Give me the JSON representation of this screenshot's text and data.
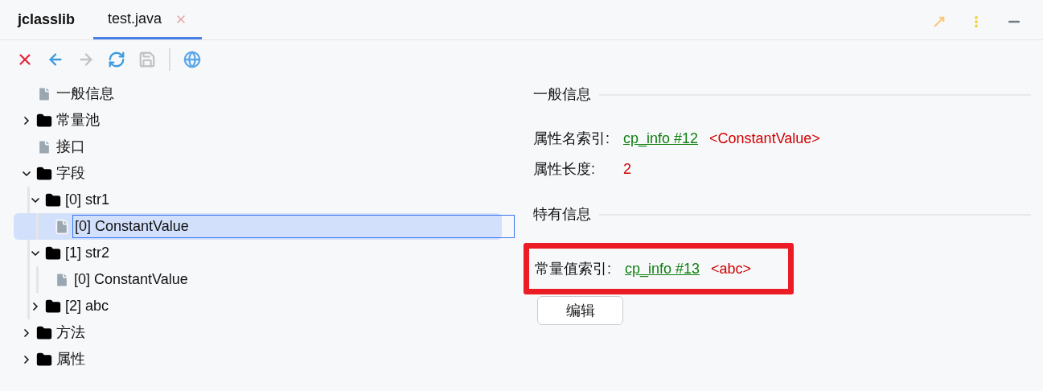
{
  "app_title": "jclasslib",
  "tabs": [
    {
      "label": "test.java",
      "selected": true
    }
  ],
  "toolbar": [
    {
      "kind": "close",
      "disabled": false
    },
    {
      "kind": "back",
      "disabled": false
    },
    {
      "kind": "forward",
      "disabled": true
    },
    {
      "kind": "refresh",
      "disabled": false
    },
    {
      "kind": "save",
      "disabled": true
    },
    {
      "kind": "separator"
    },
    {
      "kind": "web",
      "disabled": false
    }
  ],
  "tree": [
    {
      "label": "一般信息",
      "kind": "file",
      "selected": false
    },
    {
      "label": "常量池",
      "kind": "folder",
      "expanded": false,
      "selected": false
    },
    {
      "label": "接口",
      "kind": "file",
      "selected": false
    },
    {
      "label": "字段",
      "kind": "folder",
      "expanded": true,
      "selected": false,
      "children": [
        {
          "label": "[0] str1",
          "kind": "folder",
          "expanded": true,
          "selected": false,
          "children": [
            {
              "label": "[0] ConstantValue",
              "kind": "file",
              "selected": true
            }
          ]
        },
        {
          "label": "[1] str2",
          "kind": "folder",
          "expanded": true,
          "selected": false,
          "children": [
            {
              "label": "[0] ConstantValue",
              "kind": "file",
              "selected": false
            }
          ]
        },
        {
          "label": "[2] abc",
          "kind": "folder",
          "expanded": false,
          "selected": false
        }
      ]
    },
    {
      "label": "方法",
      "kind": "folder",
      "expanded": false,
      "selected": false
    },
    {
      "label": "属性",
      "kind": "folder",
      "expanded": false,
      "selected": false
    }
  ],
  "sections": [
    {
      "title": "一般信息",
      "fields": [
        {
          "label": "属性名索引:",
          "link": "cp_info #12",
          "value": "<ConstantValue>",
          "highlighted": false
        },
        {
          "label": "属性长度:",
          "value": "2",
          "highlighted": false
        }
      ]
    },
    {
      "title": "特有信息",
      "fields": [
        {
          "label": "常量值索引:",
          "link": "cp_info #13",
          "value": "<abc>",
          "highlighted": true
        }
      ]
    }
  ],
  "edit_button": "编辑"
}
